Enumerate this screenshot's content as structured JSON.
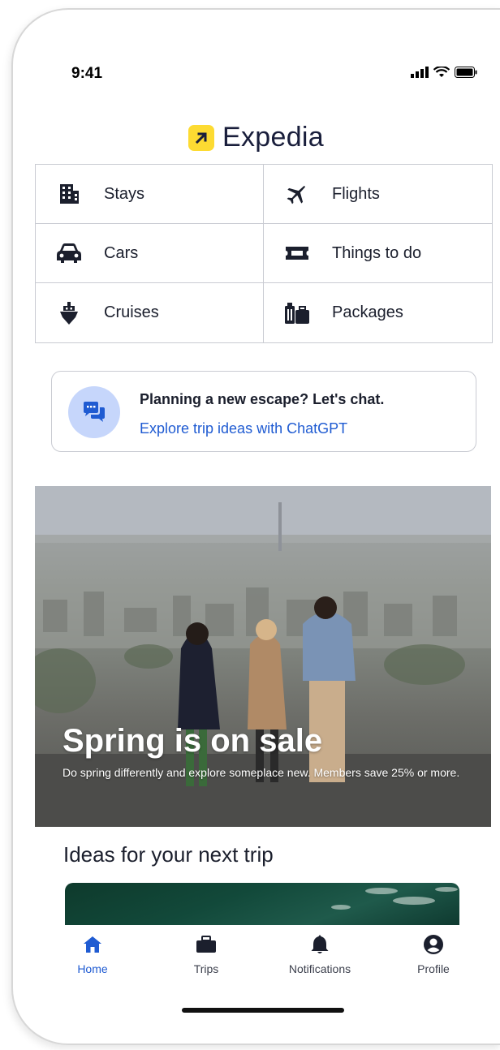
{
  "status_bar": {
    "time": "9:41"
  },
  "brand": {
    "name": "Expedia",
    "accent": "#fddb32",
    "text_color": "#191e3b"
  },
  "categories": [
    {
      "label": "Stays",
      "icon": "building-icon"
    },
    {
      "label": "Flights",
      "icon": "airplane-icon"
    },
    {
      "label": "Cars",
      "icon": "car-icon"
    },
    {
      "label": "Things to do",
      "icon": "ticket-icon"
    },
    {
      "label": "Cruises",
      "icon": "ship-icon"
    },
    {
      "label": "Packages",
      "icon": "luggage-icon"
    }
  ],
  "chat_card": {
    "title": "Planning a new escape? Let's chat.",
    "link": "Explore trip ideas with ChatGPT",
    "link_color": "#1f5bd2"
  },
  "hero": {
    "title": "Spring is on sale",
    "subtitle": "Do spring differently and explore someplace new. Members save 25% or more."
  },
  "ideas": {
    "title": "Ideas for your next trip"
  },
  "tabbar": {
    "items": [
      {
        "label": "Home",
        "icon": "home-icon",
        "active": true
      },
      {
        "label": "Trips",
        "icon": "briefcase-icon",
        "active": false
      },
      {
        "label": "Notifications",
        "icon": "bell-icon",
        "active": false
      },
      {
        "label": "Profile",
        "icon": "profile-icon",
        "active": false
      }
    ],
    "active_color": "#1f5bd2"
  }
}
